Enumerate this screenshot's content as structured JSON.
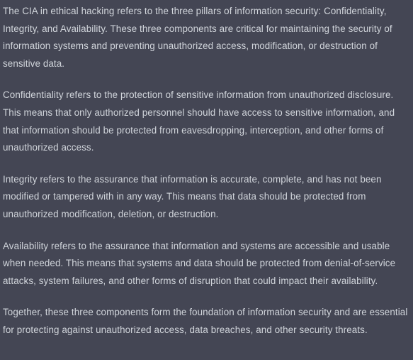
{
  "response": {
    "paragraphs": [
      "The CIA in ethical hacking refers to the three pillars of information security: Confidentiality, Integrity, and Availability. These three components are critical for maintaining the security of information systems and preventing unauthorized access, modification, or destruction of sensitive data.",
      "Confidentiality refers to the protection of sensitive information from unauthorized disclosure. This means that only authorized personnel should have access to sensitive information, and that information should be protected from eavesdropping, interception, and other forms of unauthorized access.",
      "Integrity refers to the assurance that information is accurate, complete, and has not been modified or tampered with in any way. This means that data should be protected from unauthorized modification, deletion, or destruction.",
      "Availability refers to the assurance that information and systems are accessible and usable when needed. This means that systems and data should be protected from denial-of-service attacks, system failures, and other forms of disruption that could impact their availability.",
      "Together, these three components form the foundation of information security and are essential for protecting against unauthorized access, data breaches, and other security threats."
    ]
  },
  "colors": {
    "background": "#444654",
    "text": "#d1d5db"
  }
}
